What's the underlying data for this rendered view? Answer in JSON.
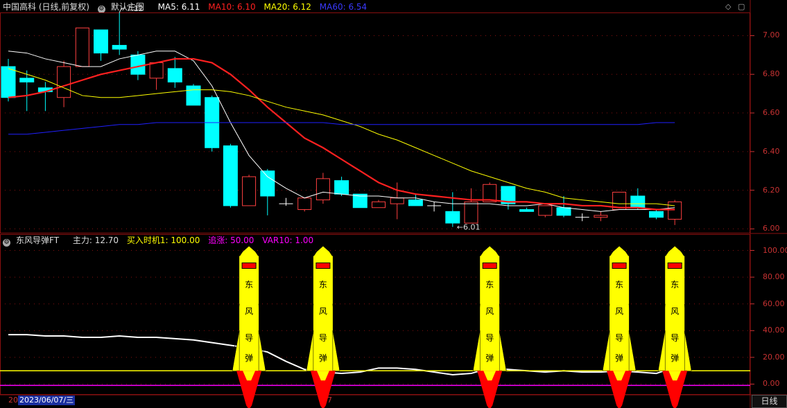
{
  "main_header": {
    "stock": "中国高科 (日线,前复权)",
    "template": "默认主图",
    "ma5": {
      "label": "MA5: 6.11",
      "color": "#ffffff"
    },
    "ma10": {
      "label": "MA10: 6.10",
      "color": "#ff2020"
    },
    "ma20": {
      "label": "MA20: 6.12",
      "color": "#ffff00"
    },
    "ma60": {
      "label": "MA60: 6.54",
      "color": "#2020ff"
    }
  },
  "sub_header": {
    "indicator": "东风导弹FT",
    "main_force": {
      "label": "主力: 12.70",
      "color": "#dddddd"
    },
    "buy_signal": {
      "label": "买入时机1: 100.00",
      "color": "#ffff00"
    },
    "chase": {
      "label": "追涨: 50.00",
      "color": "#ff00ff"
    },
    "var10": {
      "label": "VAR10: 1.00",
      "color": "#ff00ff"
    }
  },
  "toolbar": {
    "diamond_icon": "◇",
    "box_icon": "▢"
  },
  "date_prefix": "20",
  "date_label": "2023/06/07/三",
  "date_tick": "7",
  "period_button": "日线",
  "chart_data": [
    {
      "type": "candlestick",
      "title": "中国高科 (日线,前复权)",
      "ylim": [
        5.98,
        7.12
      ],
      "y_ticks": [
        "7.00",
        "6.80",
        "6.60",
        "6.40",
        "6.20",
        "6.00"
      ],
      "annotations": [
        {
          "text": "7.12",
          "index": 6
        },
        {
          "text": "←6.01",
          "index": 24
        }
      ],
      "candles": [
        {
          "o": 6.84,
          "h": 6.88,
          "l": 6.66,
          "c": 6.68
        },
        {
          "o": 6.78,
          "h": 6.82,
          "l": 6.61,
          "c": 6.76
        },
        {
          "o": 6.73,
          "h": 6.76,
          "l": 6.61,
          "c": 6.71
        },
        {
          "o": 6.68,
          "h": 6.87,
          "l": 6.63,
          "c": 6.84
        },
        {
          "o": 6.84,
          "h": 7.04,
          "l": 6.84,
          "c": 7.04
        },
        {
          "o": 7.03,
          "h": 7.03,
          "l": 6.87,
          "c": 6.91
        },
        {
          "o": 6.95,
          "h": 7.12,
          "l": 6.9,
          "c": 6.93
        },
        {
          "o": 6.9,
          "h": 6.92,
          "l": 6.77,
          "c": 6.8
        },
        {
          "o": 6.78,
          "h": 6.86,
          "l": 6.72,
          "c": 6.86
        },
        {
          "o": 6.83,
          "h": 6.89,
          "l": 6.73,
          "c": 6.76
        },
        {
          "o": 6.74,
          "h": 6.75,
          "l": 6.64,
          "c": 6.64
        },
        {
          "o": 6.68,
          "h": 6.69,
          "l": 6.4,
          "c": 6.42
        },
        {
          "o": 6.43,
          "h": 6.44,
          "l": 6.11,
          "c": 6.12
        },
        {
          "o": 6.12,
          "h": 6.28,
          "l": 6.12,
          "c": 6.27
        },
        {
          "o": 6.3,
          "h": 6.31,
          "l": 6.07,
          "c": 6.17
        },
        {
          "o": 6.13,
          "h": 6.16,
          "l": 6.12,
          "c": 6.13
        },
        {
          "o": 6.1,
          "h": 6.16,
          "l": 6.09,
          "c": 6.16
        },
        {
          "o": 6.15,
          "h": 6.29,
          "l": 6.13,
          "c": 6.26
        },
        {
          "o": 6.25,
          "h": 6.27,
          "l": 6.17,
          "c": 6.18
        },
        {
          "o": 6.18,
          "h": 6.18,
          "l": 6.11,
          "c": 6.11
        },
        {
          "o": 6.11,
          "h": 6.15,
          "l": 6.11,
          "c": 6.14
        },
        {
          "o": 6.13,
          "h": 6.24,
          "l": 6.05,
          "c": 6.16
        },
        {
          "o": 6.15,
          "h": 6.18,
          "l": 6.12,
          "c": 6.12
        },
        {
          "o": 6.12,
          "h": 6.14,
          "l": 6.09,
          "c": 6.12
        },
        {
          "o": 6.09,
          "h": 6.19,
          "l": 6.01,
          "c": 6.03
        },
        {
          "o": 6.03,
          "h": 6.21,
          "l": 6.03,
          "c": 6.14
        },
        {
          "o": 6.14,
          "h": 6.24,
          "l": 6.14,
          "c": 6.23
        },
        {
          "o": 6.22,
          "h": 6.22,
          "l": 6.1,
          "c": 6.13
        },
        {
          "o": 6.1,
          "h": 6.11,
          "l": 6.09,
          "c": 6.09
        },
        {
          "o": 6.07,
          "h": 6.12,
          "l": 6.06,
          "c": 6.12
        },
        {
          "o": 6.11,
          "h": 6.17,
          "l": 6.06,
          "c": 6.07
        },
        {
          "o": 6.06,
          "h": 6.08,
          "l": 6.04,
          "c": 6.06
        },
        {
          "o": 6.06,
          "h": 6.09,
          "l": 6.04,
          "c": 6.07
        },
        {
          "o": 6.1,
          "h": 6.19,
          "l": 6.1,
          "c": 6.19
        },
        {
          "o": 6.17,
          "h": 6.21,
          "l": 6.1,
          "c": 6.11
        },
        {
          "o": 6.09,
          "h": 6.1,
          "l": 6.05,
          "c": 6.06
        },
        {
          "o": 6.05,
          "h": 6.15,
          "l": 6.02,
          "c": 6.14
        }
      ],
      "series": [
        {
          "name": "MA5",
          "color": "#ffffff",
          "width": 1,
          "start": 0,
          "values": [
            6.92,
            6.91,
            6.88,
            6.86,
            6.84,
            6.84,
            6.88,
            6.9,
            6.92,
            6.92,
            6.87,
            6.74,
            6.55,
            6.38,
            6.27,
            6.21,
            6.16,
            6.19,
            6.18,
            6.17,
            6.17,
            6.16,
            6.16,
            6.14,
            6.13,
            6.13,
            6.13,
            6.12,
            6.12,
            6.13,
            6.11,
            6.1,
            6.09,
            6.1,
            6.1,
            6.1,
            6.11
          ]
        },
        {
          "name": "MA10",
          "color": "#ff2020",
          "width": 2.2,
          "start": 0,
          "values": [
            6.68,
            6.69,
            6.71,
            6.74,
            6.77,
            6.8,
            6.82,
            6.84,
            6.86,
            6.88,
            6.88,
            6.86,
            6.8,
            6.72,
            6.63,
            6.55,
            6.47,
            6.42,
            6.36,
            6.3,
            6.24,
            6.2,
            6.18,
            6.17,
            6.16,
            6.15,
            6.15,
            6.14,
            6.14,
            6.13,
            6.13,
            6.12,
            6.12,
            6.11,
            6.11,
            6.1,
            6.1
          ]
        },
        {
          "name": "MA20",
          "color": "#ffff00",
          "width": 1,
          "start": 0,
          "values": [
            6.83,
            6.8,
            6.77,
            6.73,
            6.69,
            6.68,
            6.68,
            6.69,
            6.7,
            6.71,
            6.72,
            6.72,
            6.71,
            6.69,
            6.66,
            6.63,
            6.61,
            6.59,
            6.56,
            6.53,
            6.49,
            6.46,
            6.42,
            6.38,
            6.34,
            6.3,
            6.27,
            6.24,
            6.21,
            6.19,
            6.16,
            6.15,
            6.14,
            6.13,
            6.13,
            6.13,
            6.12
          ]
        },
        {
          "name": "MA60",
          "color": "#2020ff",
          "width": 1,
          "start": 0,
          "values": [
            6.49,
            6.49,
            6.5,
            6.51,
            6.52,
            6.53,
            6.54,
            6.54,
            6.55,
            6.55,
            6.55,
            6.55,
            6.55,
            6.55,
            6.55,
            6.55,
            6.55,
            6.55,
            6.54,
            6.54,
            6.54,
            6.54,
            6.54,
            6.54,
            6.54,
            6.54,
            6.54,
            6.54,
            6.54,
            6.54,
            6.54,
            6.54,
            6.54,
            6.54,
            6.54,
            6.55,
            6.55
          ]
        }
      ]
    },
    {
      "type": "line",
      "title": "东风导弹FT",
      "ylim": [
        -7,
        107
      ],
      "y_ticks": [
        "100.00",
        "80.00",
        "60.00",
        "40.00",
        "20.00",
        "0.00"
      ],
      "series": [
        {
          "name": "主力",
          "color": "#ffffff",
          "values": [
            37,
            37,
            36,
            36,
            35,
            35,
            36,
            35,
            35,
            34,
            33,
            31,
            29,
            27,
            24,
            17,
            11,
            9,
            8,
            9,
            12,
            12,
            11,
            9,
            7,
            8,
            12,
            11,
            10,
            9,
            10,
            9,
            9,
            10,
            9,
            8,
            12.7
          ]
        },
        {
          "name": "买入时机1",
          "color": "#ffff00",
          "constant": 10
        },
        {
          "name": "VAR10",
          "color": "#ff00ff",
          "constant": -1
        }
      ],
      "missiles": {
        "indices": [
          13,
          17,
          26,
          33,
          36
        ],
        "labels": [
          "东",
          "风",
          "导",
          "弹"
        ]
      }
    }
  ]
}
